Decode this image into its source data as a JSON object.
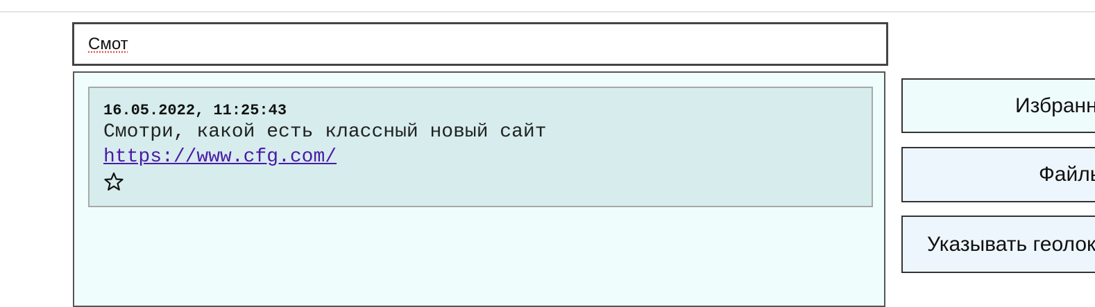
{
  "search": {
    "value": "Смот"
  },
  "messages": [
    {
      "timestamp": "16.05.2022, 11:25:43",
      "text": "Смотри, какой есть классный новый сайт",
      "link": "https://www.cfg.com/",
      "favorite_icon": "star-outline-icon"
    }
  ],
  "side_buttons": {
    "favorites": "Избранное",
    "files": "Файлы",
    "geolocation": "Указывать геолокацию"
  },
  "colors": {
    "feed_background": "#effdfd",
    "message_background": "#d7eded",
    "link": "#4a1aa8",
    "button_background": "#eef6fd"
  }
}
